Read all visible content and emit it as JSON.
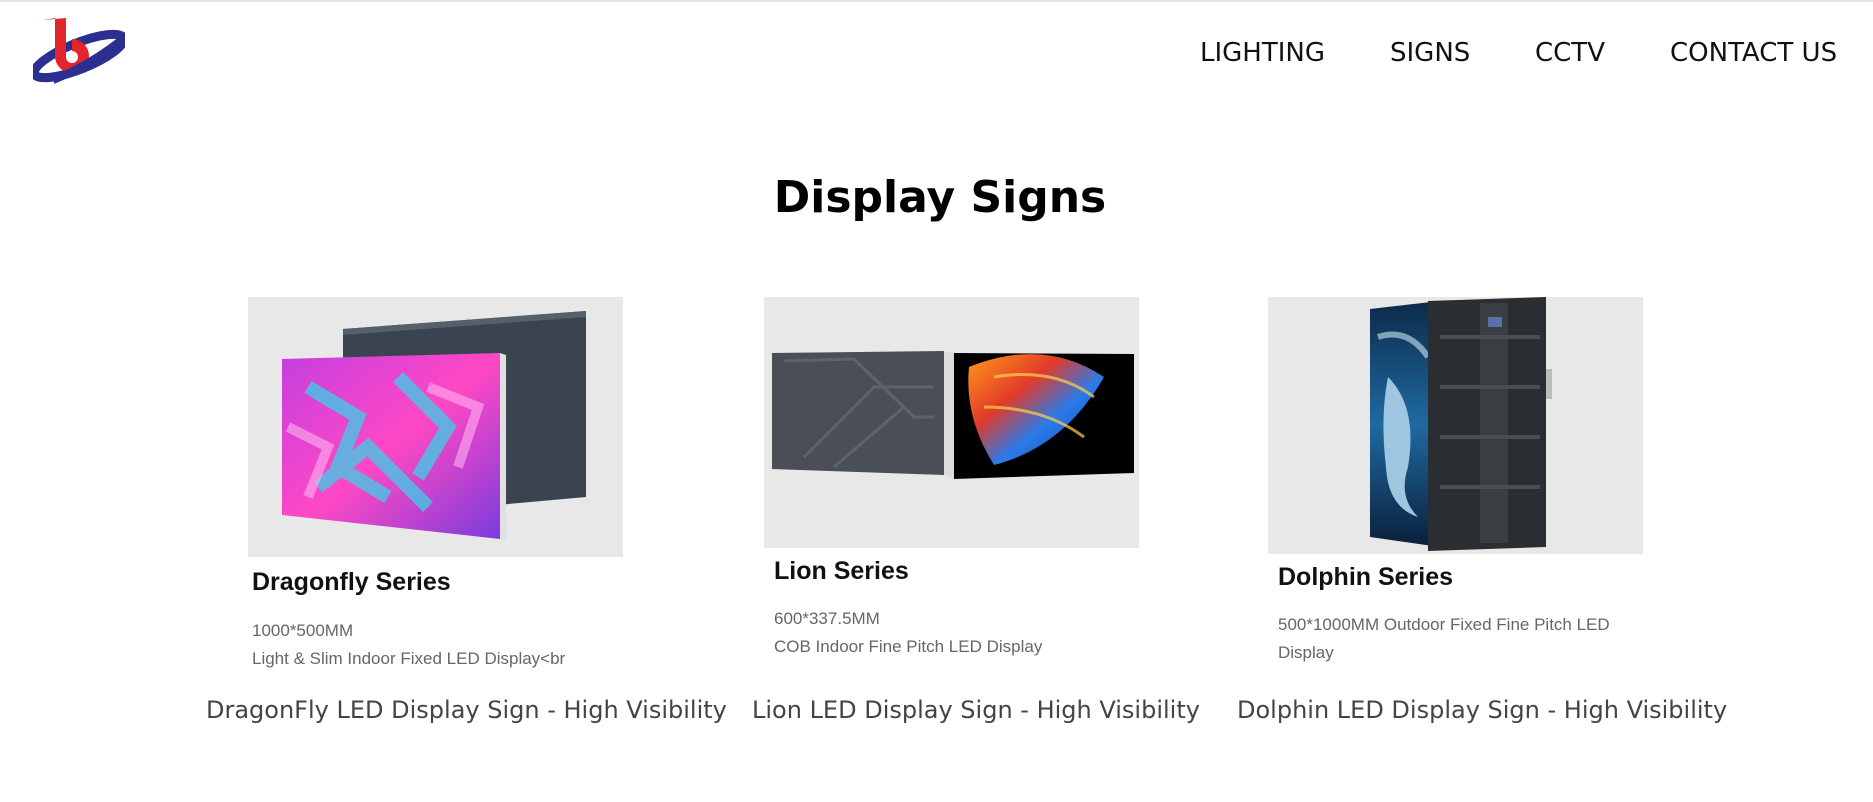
{
  "nav": {
    "items": [
      {
        "label": "LIGHTING"
      },
      {
        "label": "SIGNS"
      },
      {
        "label": "CCTV"
      },
      {
        "label": "CONTACT US"
      }
    ]
  },
  "page": {
    "title": "Display Signs"
  },
  "products": [
    {
      "series": "Dragonfly Series",
      "spec_size": "1000*500MM",
      "spec_desc": "Light & Slim Indoor Fixed LED Display<br",
      "caption": "DragonFly LED Display Sign - High Visibility"
    },
    {
      "series": "Lion Series",
      "spec_size": "600*337.5MM",
      "spec_desc": "COB Indoor Fine Pitch LED Display",
      "caption": "Lion LED Display Sign - High Visibility"
    },
    {
      "series": "Dolphin Series",
      "spec_desc": "500*1000MM Outdoor Fixed Fine Pitch LED Display",
      "caption": "Dolphin LED Display Sign - High Visibility"
    }
  ],
  "colors": {
    "logo_red": "#e0262b",
    "logo_blue": "#2b2f8f",
    "image_bg": "#e8e8e8"
  }
}
